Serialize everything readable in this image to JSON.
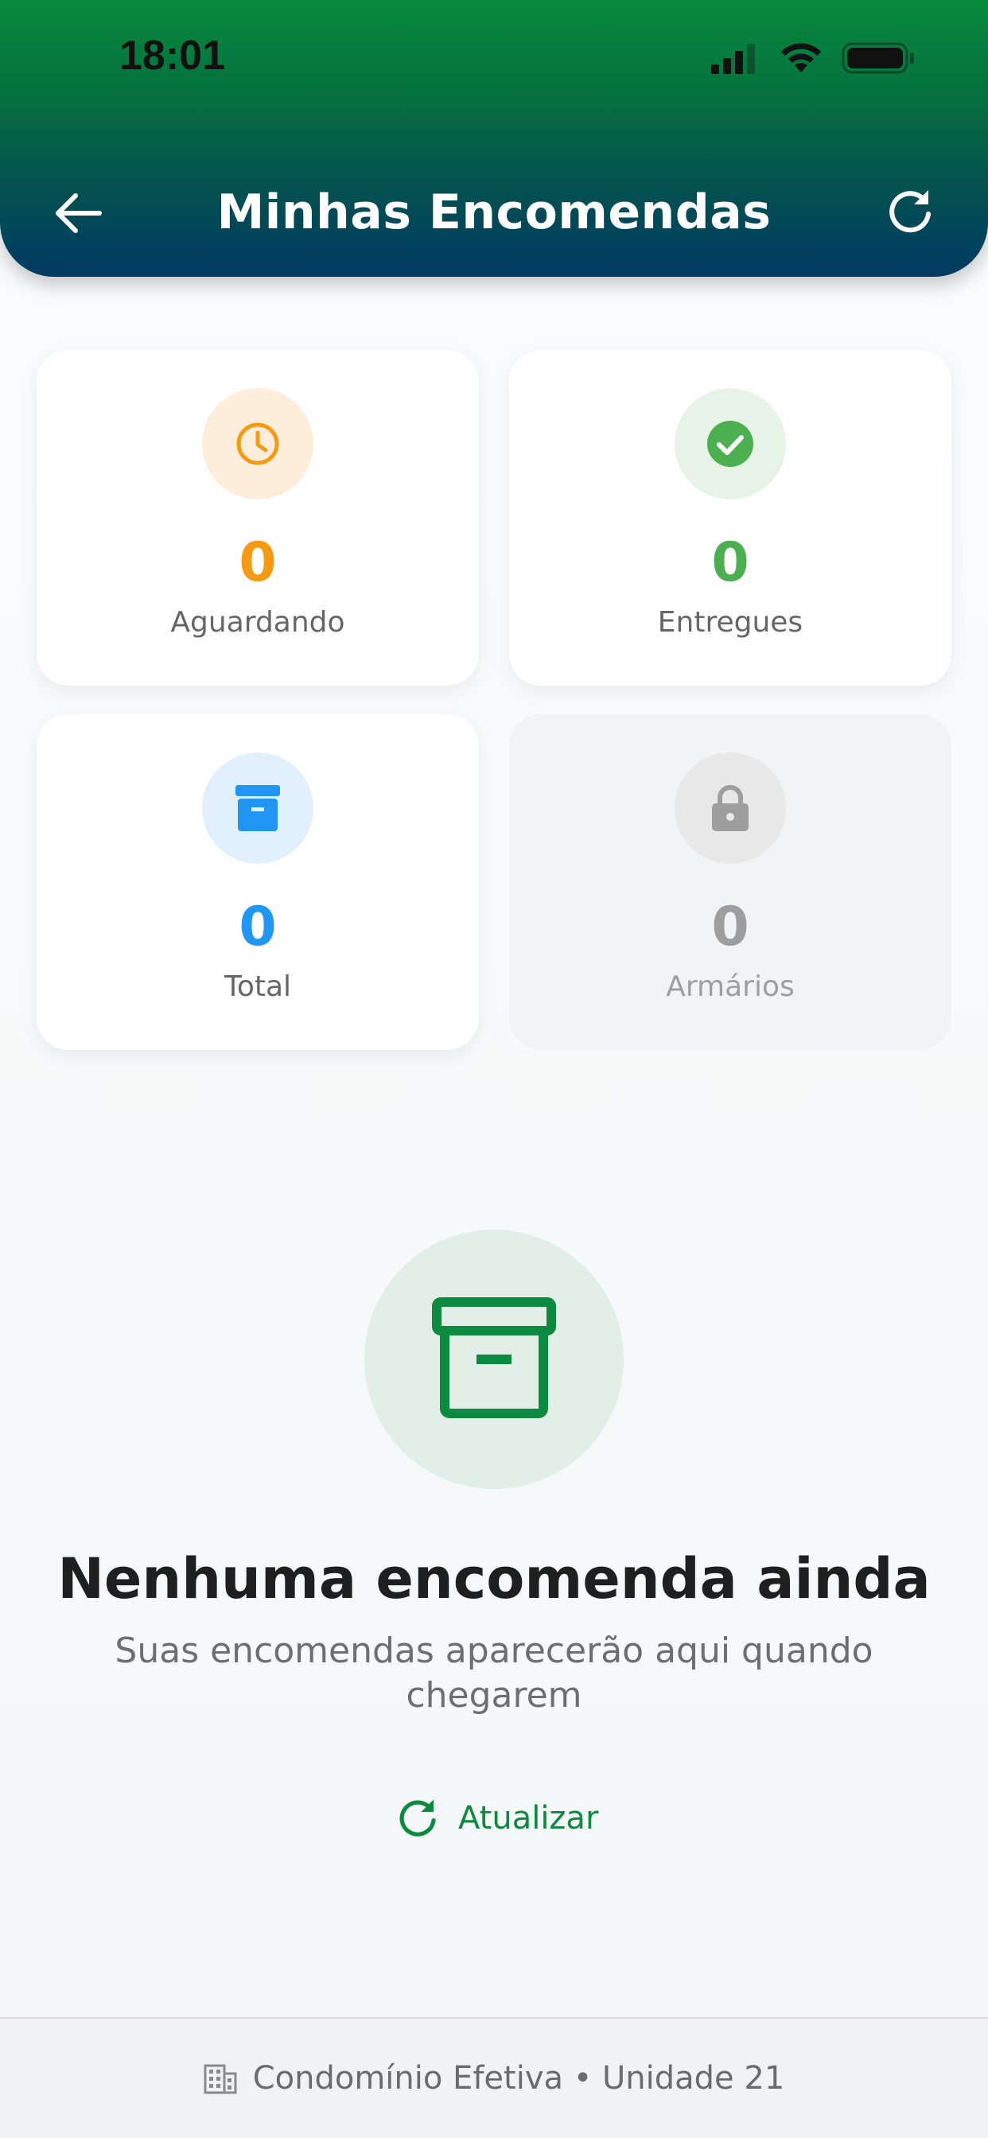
{
  "status_bar": {
    "time": "18:01"
  },
  "header": {
    "title": "Minhas Encomendas",
    "back_icon": "arrow-left-icon",
    "refresh_icon": "refresh-icon"
  },
  "stats": [
    {
      "value": "0",
      "label": "Aguardando",
      "icon": "clock-icon",
      "color": "#f59a12",
      "bg": "#fdeedb"
    },
    {
      "value": "0",
      "label": "Entregues",
      "icon": "check-circle-icon",
      "color": "#4caf50",
      "bg": "#e8f3e7"
    },
    {
      "value": "0",
      "label": "Total",
      "icon": "archive-icon",
      "color": "#2196f3",
      "bg": "#e2f0fd"
    },
    {
      "value": "0",
      "label": "Armários",
      "icon": "lock-icon",
      "color": "#9e9e9e",
      "bg": "#e8e8e8"
    }
  ],
  "empty_state": {
    "icon": "archive-icon",
    "title": "Nenhuma encomenda ainda",
    "subtitle": "Suas encomendas aparecerão aqui quando chegarem",
    "action_label": "Atualizar",
    "action_icon": "refresh-icon",
    "accent": "#0c8a3f"
  },
  "footer": {
    "icon": "building-icon",
    "text": "Condomínio Efetiva • Unidade 21"
  }
}
